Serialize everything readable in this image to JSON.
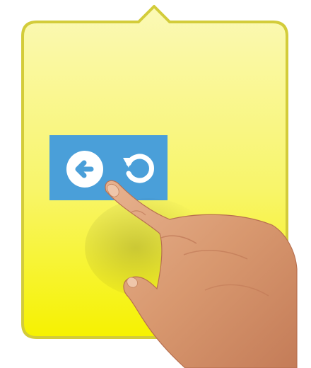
{
  "colors": {
    "panel_fill_top": "#fbf8a8",
    "panel_fill_bottom": "#f7f200",
    "panel_border": "#d6cf3a",
    "toolbar": "#4a9fd9",
    "icon": "#ffffff"
  },
  "toolbar": {
    "buttons": [
      {
        "icon": "arrow-left-circle-icon",
        "action": "back"
      },
      {
        "icon": "rotate-ccw-icon",
        "action": "redo"
      }
    ]
  },
  "overlay": {
    "image": "hand-pointing-finger"
  }
}
